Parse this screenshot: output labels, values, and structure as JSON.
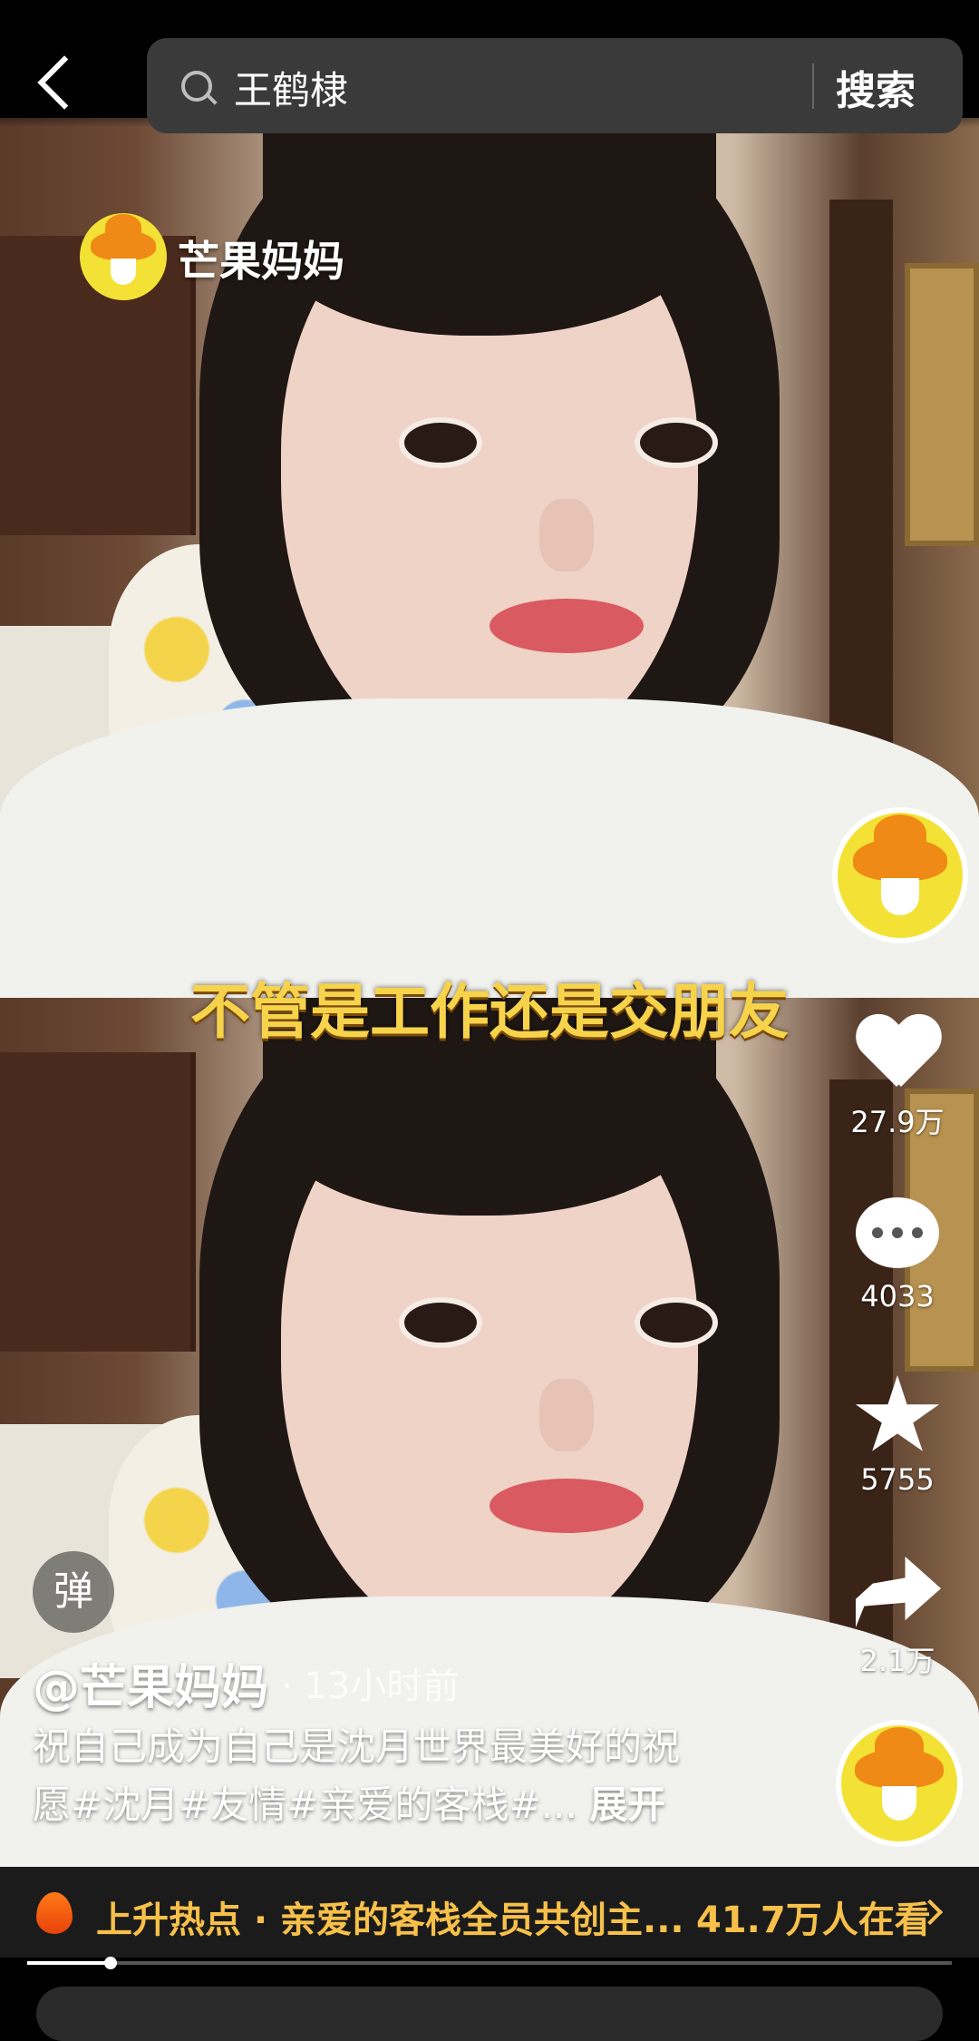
{
  "search": {
    "query": "王鹤棣",
    "button_label": "搜索"
  },
  "watermark": {
    "account": "芒果妈妈"
  },
  "video": {
    "subtitle": "不管是工作还是交朋友"
  },
  "actions": {
    "likes": "27.9万",
    "comments": "4033",
    "favorites": "5755",
    "shares": "2.1万"
  },
  "danmaku": {
    "label": "弹"
  },
  "post": {
    "author": "@芒果妈妈",
    "time": "· 13小时前",
    "caption_line1": "祝自己成为自己是沈月世界最美好的祝",
    "caption_line2": "愿#沈月#友情#亲爱的客栈#...",
    "expand_label": "展开"
  },
  "hot_topic": {
    "title": "上升热点 · 亲爱的客栈全员共创主...",
    "watching": "41.7万人在看"
  },
  "playback": {
    "progress": 0.09
  },
  "icons": [
    "back-icon",
    "search-icon",
    "heart-icon",
    "comment-icon",
    "star-icon",
    "share-icon",
    "flame-icon",
    "chevron-right-icon"
  ],
  "colors": {
    "subtitle": "#f6d34b",
    "hot_text": "#f7c04a",
    "avatar_bg": "#f3e235",
    "hat": "#f08a17"
  }
}
